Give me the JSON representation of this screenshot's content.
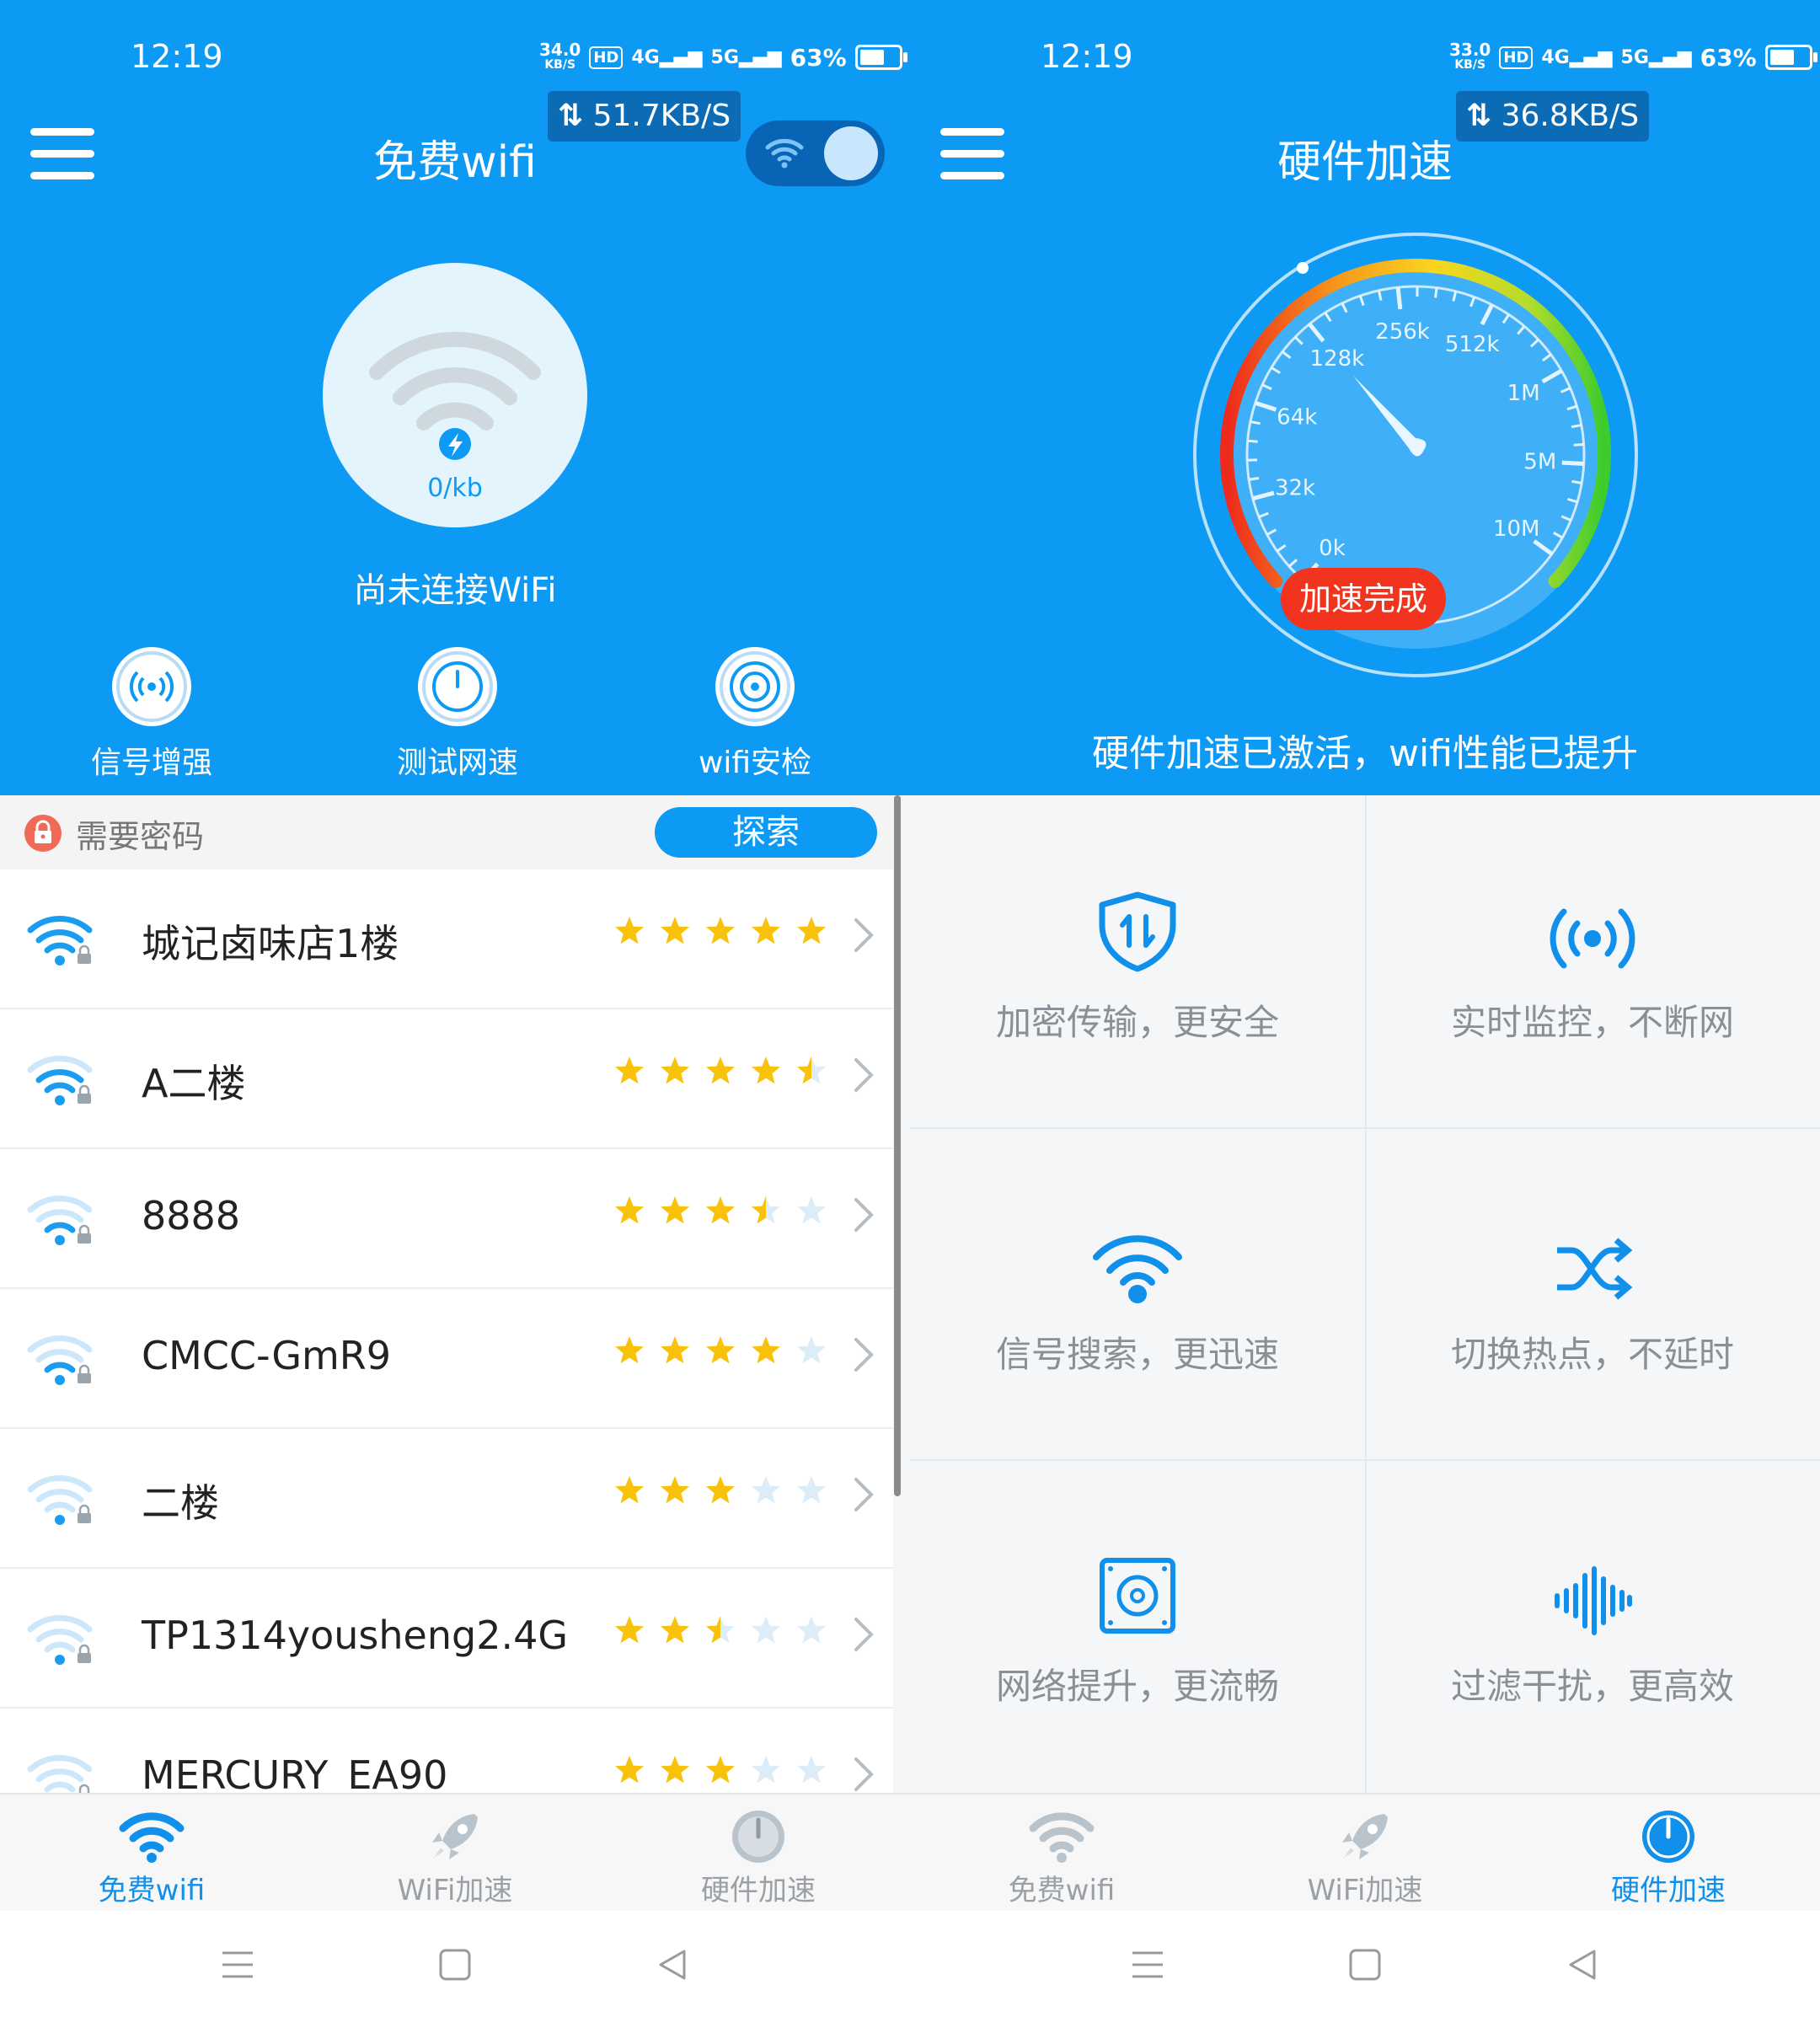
{
  "left": {
    "status_bar": {
      "time": "12:19",
      "net_speed": "34.0",
      "net_speed_unit": "KB/S",
      "hd": "HD",
      "sig4g": "4G",
      "sig5g": "5G",
      "battery": "63%"
    },
    "speed_pill": "51.7KB/S",
    "title": "免费wifi",
    "toggle_on": true,
    "circle_value": "0/kb",
    "not_connected": "尚未连接WiFi",
    "tools": [
      {
        "label": "信号增强",
        "icon": "signal-boost-icon"
      },
      {
        "label": "测试网速",
        "icon": "speed-test-icon"
      },
      {
        "label": "wifi安检",
        "icon": "security-check-icon"
      }
    ],
    "password_label": "需要密码",
    "explore_label": "探索",
    "networks": [
      {
        "name": "城记卤味店1楼",
        "rating": 5,
        "signal": 4
      },
      {
        "name": "A二楼",
        "rating": 4.5,
        "signal": 3
      },
      {
        "name": "8888",
        "rating": 3.5,
        "signal": 2
      },
      {
        "name": "CMCC-GmR9",
        "rating": 4,
        "signal": 2
      },
      {
        "name": "二楼",
        "rating": 3,
        "signal": 1
      },
      {
        "name": "TP1314yousheng2.4G",
        "rating": 2.5,
        "signal": 1
      },
      {
        "name": "MERCURY_EA90",
        "rating": 3,
        "signal": 1
      }
    ],
    "nav": [
      {
        "label": "免费wifi",
        "icon": "wifi-icon",
        "active": true
      },
      {
        "label": "WiFi加速",
        "icon": "rocket-icon",
        "active": false
      },
      {
        "label": "硬件加速",
        "icon": "gauge-icon",
        "active": false
      }
    ]
  },
  "right": {
    "status_bar": {
      "time": "12:19",
      "net_speed": "33.0",
      "net_speed_unit": "KB/S",
      "hd": "HD",
      "sig4g": "4G",
      "sig5g": "5G",
      "battery": "63%"
    },
    "speed_pill": "36.8KB/S",
    "title": "硬件加速",
    "gauge_labels": [
      "0k",
      "32k",
      "64k",
      "128k",
      "256k",
      "512k",
      "1M",
      "5M",
      "10M"
    ],
    "complete_label": "加速完成",
    "activated_text": "硬件加速已激活，wifi性能已提升",
    "features": [
      {
        "label": "加密传输，更安全",
        "icon": "shield-transfer-icon"
      },
      {
        "label": "实时监控，不断网",
        "icon": "broadcast-icon"
      },
      {
        "label": "信号搜索，更迅速",
        "icon": "wifi-search-icon"
      },
      {
        "label": "切换热点，不延时",
        "icon": "shuffle-icon"
      },
      {
        "label": "网络提升，更流畅",
        "icon": "speaker-box-icon"
      },
      {
        "label": "过滤干扰，更高效",
        "icon": "soundwave-icon"
      }
    ],
    "nav": [
      {
        "label": "免费wifi",
        "icon": "wifi-icon",
        "active": false
      },
      {
        "label": "WiFi加速",
        "icon": "rocket-icon",
        "active": false
      },
      {
        "label": "硬件加速",
        "icon": "gauge-icon",
        "active": true
      }
    ]
  },
  "colors": {
    "primary": "#0d9af4",
    "star": "#f9c20a",
    "star_empty": "#dcedf8",
    "complete": "#f2341e",
    "nav_active": "#1090ea",
    "nav_inactive": "#9aa0a6"
  }
}
